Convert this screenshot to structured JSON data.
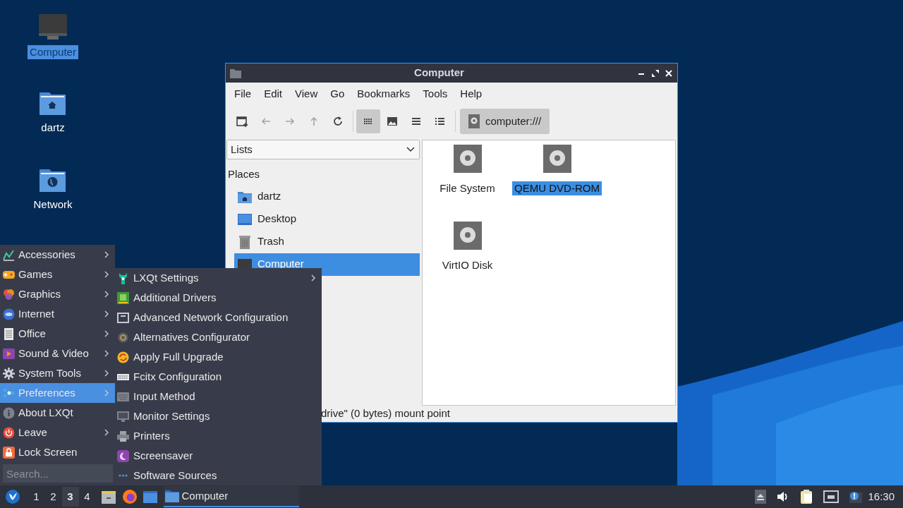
{
  "desktop_icons": [
    {
      "label": "Computer",
      "selected": true
    },
    {
      "label": "dartz",
      "selected": false
    },
    {
      "label": "Network",
      "selected": false
    }
  ],
  "window": {
    "title": "Computer",
    "menu": [
      "File",
      "Edit",
      "View",
      "Go",
      "Bookmarks",
      "Tools",
      "Help"
    ],
    "toolbar": [
      {
        "disabled": false,
        "selected": false
      },
      {
        "disabled": true,
        "selected": false
      },
      {
        "disabled": true,
        "selected": false
      },
      {
        "disabled": true,
        "selected": false
      },
      {
        "disabled": false,
        "selected": false
      },
      {
        "disabled": false,
        "selected": true
      },
      {
        "disabled": false,
        "selected": false
      },
      {
        "disabled": false,
        "selected": false
      },
      {
        "disabled": false,
        "selected": false
      }
    ],
    "location": "computer:///",
    "side_pane": {
      "dropdown": "Lists",
      "heading": "Places",
      "items": [
        {
          "label": "dartz",
          "selected": false
        },
        {
          "label": "Desktop",
          "selected": false
        },
        {
          "label": "Trash",
          "selected": false
        },
        {
          "label": "Computer",
          "selected": true
        }
      ]
    },
    "items": [
      {
        "label": "File System",
        "selected": false
      },
      {
        "label": "QEMU DVD-ROM",
        "selected": true
      },
      {
        "label": "VirtIO Disk",
        "selected": false
      }
    ],
    "status_bar": "drive\" (0 bytes) mount point"
  },
  "start_menu": {
    "items": [
      {
        "label": "Accessories",
        "submenu": true,
        "selected": false
      },
      {
        "label": "Games",
        "submenu": true,
        "selected": false
      },
      {
        "label": "Graphics",
        "submenu": true,
        "selected": false
      },
      {
        "label": "Internet",
        "submenu": true,
        "selected": false
      },
      {
        "label": "Office",
        "submenu": true,
        "selected": false
      },
      {
        "label": "Sound & Video",
        "submenu": true,
        "selected": false
      },
      {
        "label": "System Tools",
        "submenu": true,
        "selected": false
      },
      {
        "label": "Preferences",
        "submenu": true,
        "selected": true
      },
      {
        "label": "About LXQt",
        "submenu": false,
        "selected": false
      },
      {
        "label": "Leave",
        "submenu": true,
        "selected": false
      },
      {
        "label": "Lock Screen",
        "submenu": false,
        "selected": false
      }
    ],
    "search": {
      "placeholder": "Search..."
    }
  },
  "submenu": {
    "items": [
      {
        "label": "LXQt Settings",
        "submenu": true
      },
      {
        "label": "Additional Drivers",
        "submenu": false
      },
      {
        "label": "Advanced Network Configuration",
        "submenu": false
      },
      {
        "label": "Alternatives Configurator",
        "submenu": false
      },
      {
        "label": "Apply Full Upgrade",
        "submenu": false
      },
      {
        "label": "Fcitx Configuration",
        "submenu": false
      },
      {
        "label": "Input Method",
        "submenu": false
      },
      {
        "label": "Monitor Settings",
        "submenu": false
      },
      {
        "label": "Printers",
        "submenu": false
      },
      {
        "label": "Screensaver",
        "submenu": false
      },
      {
        "label": "Software Sources",
        "submenu": false
      }
    ]
  },
  "taskbar": {
    "desktops": [
      {
        "label": "1",
        "selected": false
      },
      {
        "label": "2",
        "selected": false
      },
      {
        "label": "3",
        "selected": true
      },
      {
        "label": "4",
        "selected": false
      }
    ],
    "task": {
      "label": "Computer",
      "selected": true
    },
    "clock": "16:30"
  }
}
